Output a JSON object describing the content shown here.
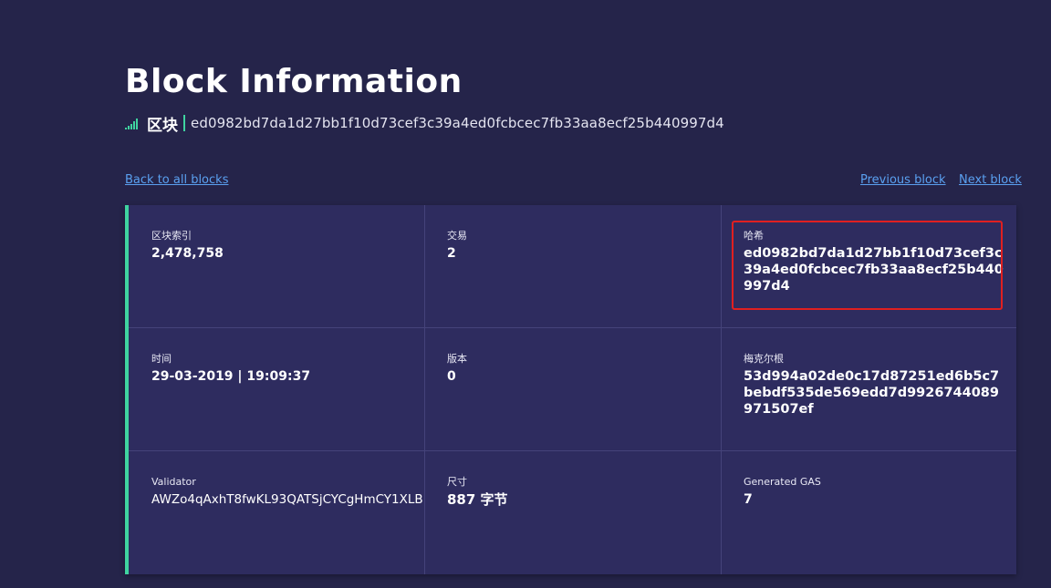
{
  "page": {
    "title": "Block Information",
    "subtitle_type": "区块",
    "subtitle_hash": "ed0982bd7da1d27bb1f10d73cef3c39a4ed0fcbcec7fb33aa8ecf25b440997d4"
  },
  "nav": {
    "back": "Back to all blocks",
    "previous": "Previous block",
    "next": "Next block"
  },
  "fields": {
    "index": {
      "label": "区块索引",
      "value": "2,478,758"
    },
    "transactions": {
      "label": "交易",
      "value": "2"
    },
    "hash": {
      "label": "哈希",
      "value": "ed0982bd7da1d27bb1f10d73cef3c39a4ed0fcbcec7fb33aa8ecf25b440997d4"
    },
    "time": {
      "label": "时间",
      "value": "29-03-2019 | 19:09:37"
    },
    "version": {
      "label": "版本",
      "value": "0"
    },
    "merkle_root": {
      "label": "梅克尔根",
      "value": "53d994a02de0c17d87251ed6b5c7bebdf535de569edd7d9926744089971507ef"
    },
    "validator": {
      "label": "Validator",
      "value": "AWZo4qAxhT8fwKL93QATSjCYCgHmCY1XLB"
    },
    "size": {
      "label": "尺寸",
      "value": "887 字节"
    },
    "generated_gas": {
      "label": "Generated GAS",
      "value": "7"
    }
  },
  "colors": {
    "background": "#25244a",
    "card": "#2e2c5f",
    "accent": "#3fd4a0",
    "link": "#5aa0f0",
    "highlight": "#e02020"
  },
  "icons": {
    "subtitle_icon": "signal-bars-icon"
  }
}
